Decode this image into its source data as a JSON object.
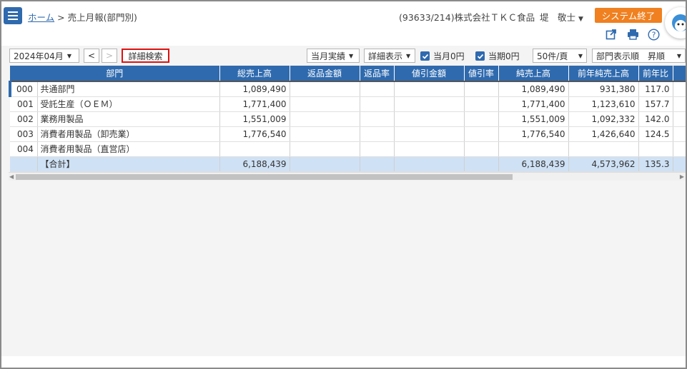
{
  "header": {
    "breadcrumb_home": "ホーム",
    "breadcrumb_sep": ">",
    "breadcrumb_current": "売上月報(部門別)",
    "company": "(93633/214)株式会社ＴＫＣ食品",
    "user": "堤　敬士",
    "system_end": "システム終了"
  },
  "toolbar": {
    "month": "2024年04月",
    "prev": "<",
    "next": ">",
    "detail_search": "詳細検索",
    "actual": "当月実績",
    "detail_display": "詳細表示",
    "zero_current": "当月0円",
    "zero_period": "当期0円",
    "per_page": "50件/頁",
    "sort": "部門表示順　昇順"
  },
  "table": {
    "columns": [
      "部門",
      "総売上高",
      "返品金額",
      "返品率",
      "値引金額",
      "値引率",
      "純売上高",
      "前年純売上高",
      "前年比"
    ],
    "rows": [
      {
        "code": "000",
        "name": "共通部門",
        "gross": "1,089,490",
        "ret_amt": "",
        "ret_rate": "",
        "disc_amt": "",
        "disc_rate": "",
        "net": "1,089,490",
        "prev_net": "931,380",
        "ratio": "117.0"
      },
      {
        "code": "001",
        "name": "受託生産（ＯＥＭ）",
        "gross": "1,771,400",
        "ret_amt": "",
        "ret_rate": "",
        "disc_amt": "",
        "disc_rate": "",
        "net": "1,771,400",
        "prev_net": "1,123,610",
        "ratio": "157.7"
      },
      {
        "code": "002",
        "name": "業務用製品",
        "gross": "1,551,009",
        "ret_amt": "",
        "ret_rate": "",
        "disc_amt": "",
        "disc_rate": "",
        "net": "1,551,009",
        "prev_net": "1,092,332",
        "ratio": "142.0"
      },
      {
        "code": "003",
        "name": "消費者用製品（卸売業）",
        "gross": "1,776,540",
        "ret_amt": "",
        "ret_rate": "",
        "disc_amt": "",
        "disc_rate": "",
        "net": "1,776,540",
        "prev_net": "1,426,640",
        "ratio": "124.5"
      },
      {
        "code": "004",
        "name": "消費者用製品（直営店）",
        "gross": "",
        "ret_amt": "",
        "ret_rate": "",
        "disc_amt": "",
        "disc_rate": "",
        "net": "",
        "prev_net": "",
        "ratio": ""
      }
    ],
    "total": {
      "code": "",
      "name": "【合計】",
      "gross": "6,188,439",
      "ret_amt": "",
      "ret_rate": "",
      "disc_amt": "",
      "disc_rate": "",
      "net": "6,188,439",
      "prev_net": "4,573,962",
      "ratio": "135.3"
    }
  },
  "colors": {
    "primary": "#2f6aae",
    "accent": "#f08020",
    "highlight": "#e01010",
    "total_row": "#cfe1f5"
  },
  "icons": [
    "menu-icon",
    "external-link-icon",
    "print-icon",
    "help-icon",
    "check-icon",
    "chevron-down-icon"
  ]
}
